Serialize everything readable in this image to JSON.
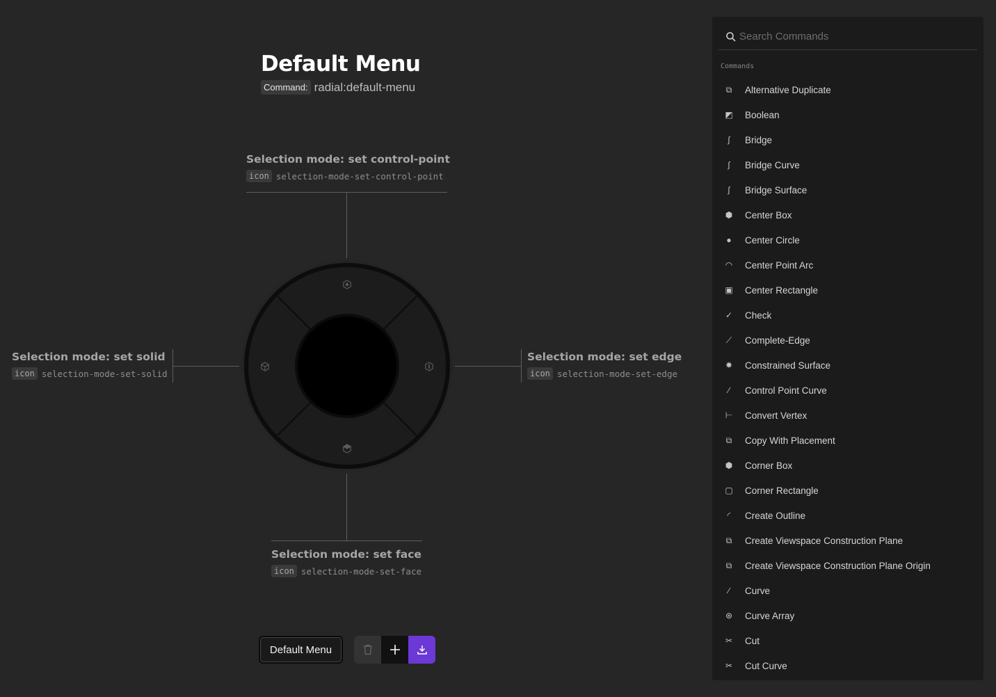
{
  "menu": {
    "title": "Default Menu",
    "command_badge": "Command:",
    "command_value": "radial:default-menu"
  },
  "radial_items": {
    "top": {
      "title": "Selection mode: set control-point",
      "badge": "icon",
      "icon_name": "selection-mode-set-control-point"
    },
    "left": {
      "title": "Selection mode: set solid",
      "badge": "icon",
      "icon_name": "selection-mode-set-solid"
    },
    "right": {
      "title": "Selection mode: set edge",
      "badge": "icon",
      "icon_name": "selection-mode-set-edge"
    },
    "bottom": {
      "title": "Selection mode: set face",
      "badge": "icon",
      "icon_name": "selection-mode-set-face"
    }
  },
  "bottom_bar": {
    "menu_name": "Default Menu",
    "delete_icon": "trash-icon",
    "add_icon": "plus-icon",
    "export_icon": "download-icon",
    "export_color": "#6c38d6"
  },
  "panel": {
    "search_placeholder": "Search Commands",
    "section_label": "Commands",
    "commands": [
      {
        "label": "Alternative Duplicate",
        "icon": "duplicate"
      },
      {
        "label": "Boolean",
        "icon": "boolean"
      },
      {
        "label": "Bridge",
        "icon": "bridge"
      },
      {
        "label": "Bridge Curve",
        "icon": "bridge"
      },
      {
        "label": "Bridge Surface",
        "icon": "bridge"
      },
      {
        "label": "Center Box",
        "icon": "box"
      },
      {
        "label": "Center Circle",
        "icon": "circle"
      },
      {
        "label": "Center Point Arc",
        "icon": "arc"
      },
      {
        "label": "Center Rectangle",
        "icon": "rect-center"
      },
      {
        "label": "Check",
        "icon": "check"
      },
      {
        "label": "Complete-Edge",
        "icon": "edge"
      },
      {
        "label": "Constrained Surface",
        "icon": "constrained"
      },
      {
        "label": "Control Point Curve",
        "icon": "curve"
      },
      {
        "label": "Convert Vertex",
        "icon": "vertex"
      },
      {
        "label": "Copy With Placement",
        "icon": "copy"
      },
      {
        "label": "Corner Box",
        "icon": "box"
      },
      {
        "label": "Corner Rectangle",
        "icon": "rect-corner"
      },
      {
        "label": "Create Outline",
        "icon": "outline"
      },
      {
        "label": "Create Viewspace Construction Plane",
        "icon": "plane"
      },
      {
        "label": "Create Viewspace Construction Plane Origin",
        "icon": "plane"
      },
      {
        "label": "Curve",
        "icon": "curve"
      },
      {
        "label": "Curve Array",
        "icon": "array"
      },
      {
        "label": "Cut",
        "icon": "scissors"
      },
      {
        "label": "Cut Curve",
        "icon": "scissors"
      }
    ]
  }
}
